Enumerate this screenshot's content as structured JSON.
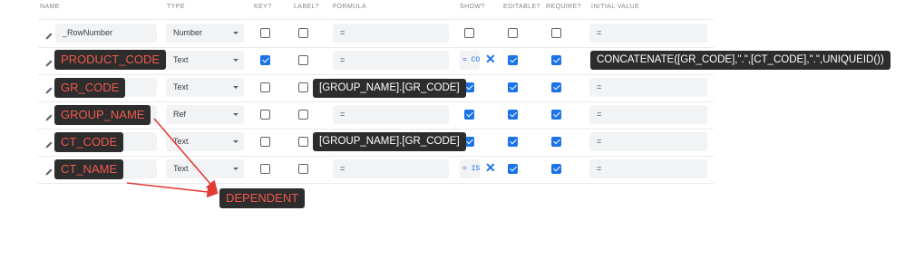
{
  "headers": {
    "name": "NAME",
    "type": "TYPE",
    "key": "KEY?",
    "label": "LABEL?",
    "formula": "FORMULA",
    "show": "SHOW?",
    "editable": "EDITABLE?",
    "require": "REQUIRE?",
    "initial": "INITIAL VALUE"
  },
  "rows": [
    {
      "name": "_RowNumber",
      "type": "Number",
      "key": false,
      "label": false,
      "formula": "=",
      "show_formula": "",
      "show": false,
      "x": false,
      "editable": false,
      "require": false,
      "initial": "="
    },
    {
      "name": "",
      "type": "Text",
      "key": true,
      "label": false,
      "formula": "=",
      "show_formula": "= CO",
      "show": false,
      "x": true,
      "editable": true,
      "require": true,
      "initial": ""
    },
    {
      "name": "",
      "type": "Text",
      "key": false,
      "label": false,
      "formula": "",
      "show_formula": "",
      "show": true,
      "x": false,
      "editable": true,
      "require": true,
      "initial": "="
    },
    {
      "name": "",
      "type": "Ref",
      "key": false,
      "label": false,
      "formula": "=",
      "show_formula": "",
      "show": true,
      "x": false,
      "editable": true,
      "require": true,
      "initial": "="
    },
    {
      "name": "",
      "type": "Text",
      "key": false,
      "label": false,
      "formula": "",
      "show_formula": "",
      "show": true,
      "x": false,
      "editable": true,
      "require": true,
      "initial": "="
    },
    {
      "name": "",
      "type": "Text",
      "key": false,
      "label": false,
      "formula": "=",
      "show_formula": "= IS",
      "show": false,
      "x": true,
      "editable": true,
      "require": true,
      "initial": "="
    }
  ],
  "annotations": {
    "product_code": "PRODUCT_CODE",
    "gr_code": "GR_CODE",
    "group_name": "GROUP_NAME",
    "ct_code": "CT_CODE",
    "ct_name": "CT_NAME",
    "dependent": "DEPENDENT",
    "formula_gr": "[GROUP_NAME].[GR_CODE]",
    "formula_ct": "[GROUP_NAME].[GR_CODE]",
    "initial_product": "CONCATENATE([GR_CODE],\".\",[CT_CODE],\".\",UNIQUEID())"
  },
  "icons": {
    "edit": "pencil-icon",
    "dropdown": "chevron-down-icon",
    "clear": "close-icon"
  },
  "colors": {
    "accent": "#1a73e8",
    "annotation_bg": "#2d2d2d",
    "annotation_text": "#f05a4f",
    "arrow": "#e53935"
  }
}
